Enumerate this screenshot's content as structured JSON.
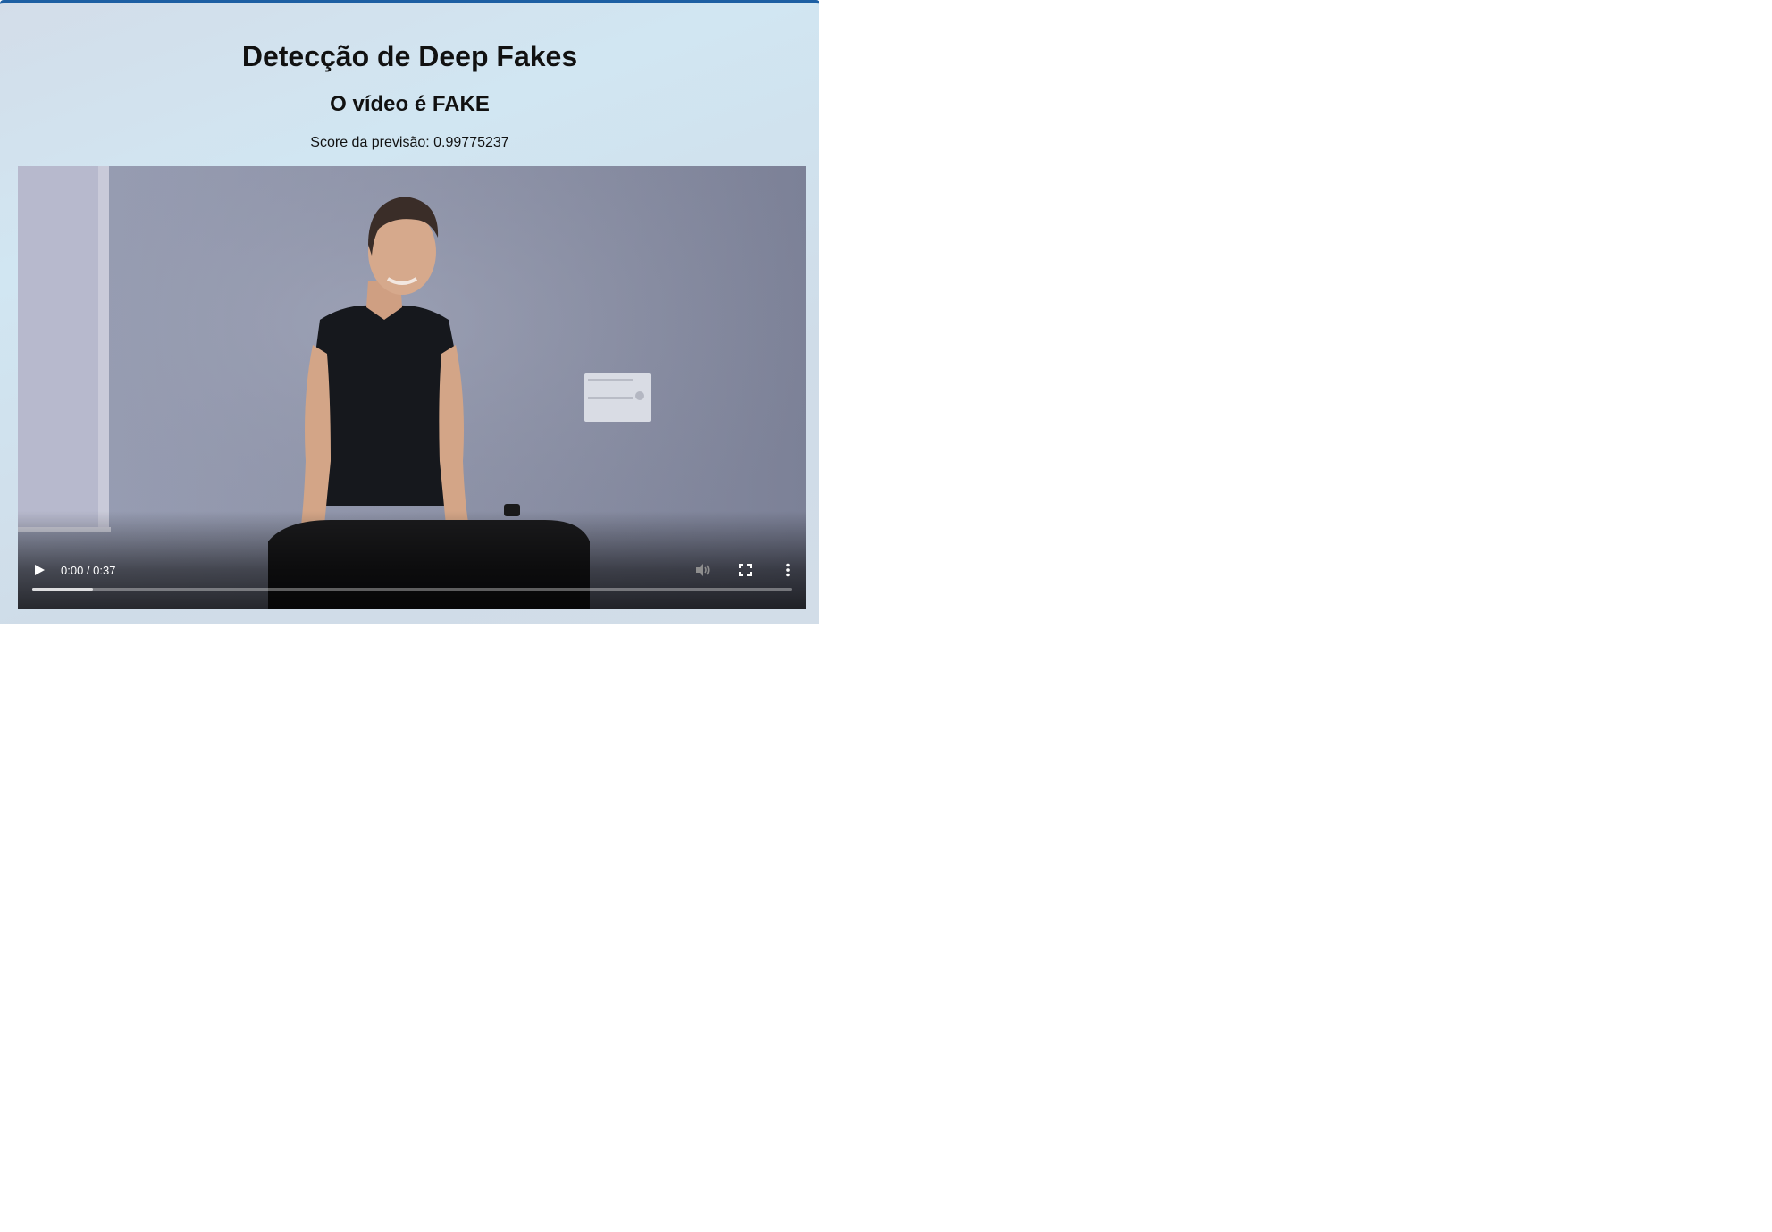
{
  "page": {
    "title": "Detecção de Deep Fakes",
    "result": "O vídeo é FAKE",
    "score_line": "Score da previsão: 0.99775237"
  },
  "video": {
    "time_display": "0:00 / 0:37",
    "buffered_fraction": 0.08,
    "icons": {
      "play": "play-icon",
      "mute": "volume-icon",
      "fullscreen": "fullscreen-icon",
      "more": "more-vert-icon"
    }
  },
  "colors": {
    "accent": "#1d5fa3"
  }
}
